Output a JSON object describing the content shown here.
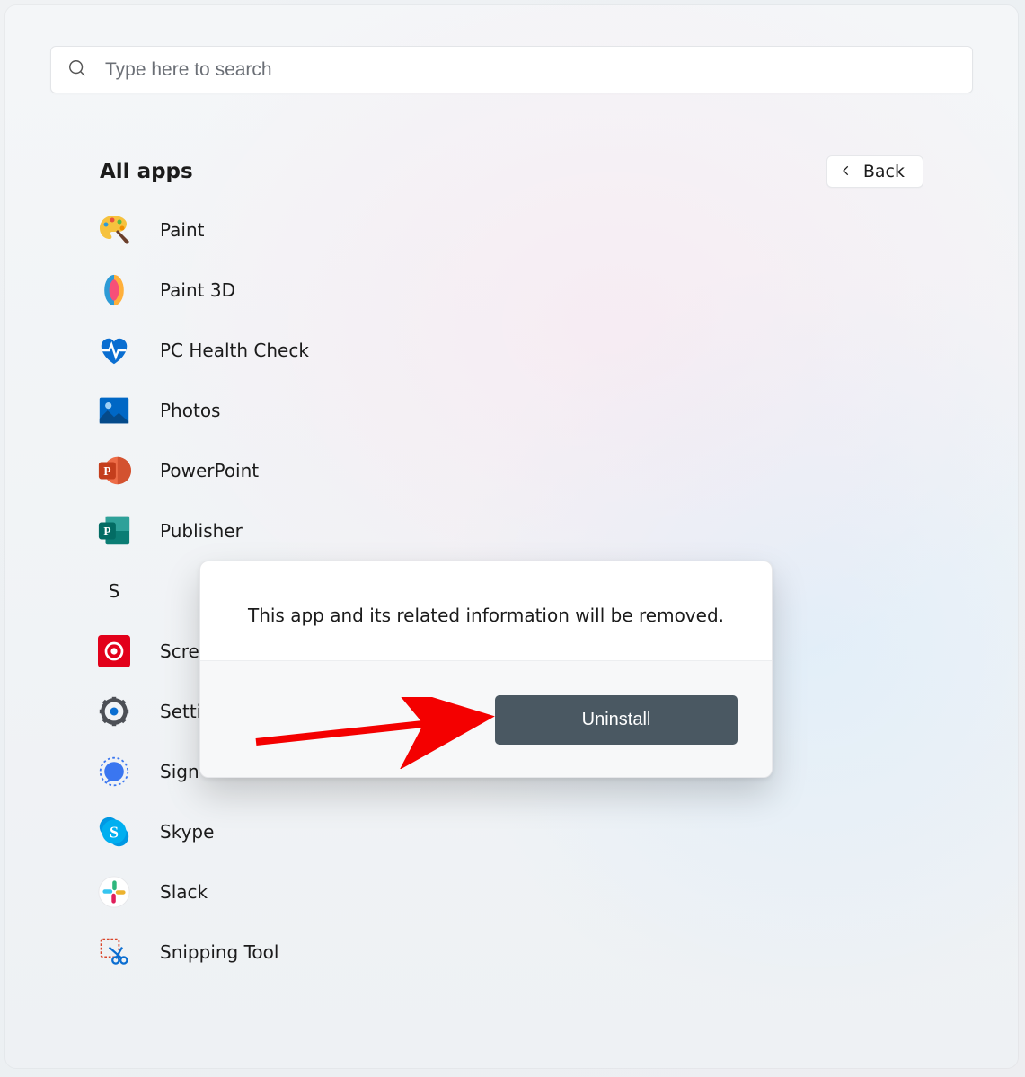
{
  "search": {
    "placeholder": "Type here to search"
  },
  "header": {
    "title": "All apps",
    "back_label": "Back"
  },
  "apps": {
    "items": [
      {
        "label": "Paint"
      },
      {
        "label": "Paint 3D"
      },
      {
        "label": "PC Health Check"
      },
      {
        "label": "Photos"
      },
      {
        "label": "PowerPoint"
      },
      {
        "label": "Publisher"
      }
    ],
    "section_letter": "S",
    "items2": [
      {
        "label": "Scre"
      },
      {
        "label": "Setti"
      },
      {
        "label": "Sign"
      },
      {
        "label": "Skype"
      },
      {
        "label": "Slack"
      },
      {
        "label": "Snipping Tool"
      }
    ]
  },
  "popup": {
    "message": "This app and its related information will be removed.",
    "action_label": "Uninstall"
  },
  "colors": {
    "accent_blue": "#0067c5",
    "uninstall_bg": "#4a5862",
    "arrow_red": "#f40000"
  }
}
